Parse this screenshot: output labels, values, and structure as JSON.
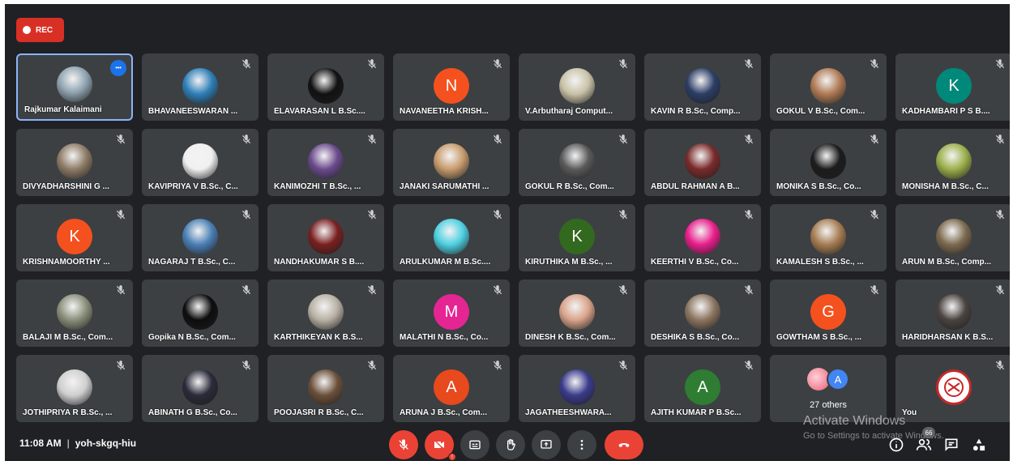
{
  "meeting": {
    "rec_label": "REC",
    "time": "11:08 AM",
    "separator": "|",
    "code": "yoh-skgq-hiu",
    "people_badge": "66",
    "watermark_title": "Activate Windows",
    "watermark_sub": "Go to Settings to activate Windows."
  },
  "colors": {
    "background": "#202124",
    "tile": "#3c4043",
    "rec": "#d93025",
    "end_call": "#ea4335",
    "self_border": "#8ab4f8"
  },
  "rows": [
    [
      {
        "name": "Rajkumar Kalaimani",
        "kind": "photo",
        "color": "#8fa3b0",
        "self": true
      },
      {
        "name": "BHAVANEESWARAN ...",
        "kind": "photo",
        "color": "#2f7fb8"
      },
      {
        "name": "ELAVARASAN L B.Sc....",
        "kind": "photo",
        "color": "#111111"
      },
      {
        "name": "NAVANEETHA KRISH...",
        "kind": "letter",
        "letter": "N",
        "color": "#f4511e"
      },
      {
        "name": "V.Arbutharaj Comput...",
        "kind": "photo",
        "color": "#c9c2a8"
      },
      {
        "name": "KAVIN R B.Sc., Comp...",
        "kind": "photo",
        "color": "#2c3e66"
      },
      {
        "name": "GOKUL V B.Sc., Com...",
        "kind": "photo",
        "color": "#b07a55"
      },
      {
        "name": "KADHAMBARI P S B....",
        "kind": "letter",
        "letter": "K",
        "color": "#00897b"
      }
    ],
    [
      {
        "name": "DIVYADHARSHINI G ...",
        "kind": "photo",
        "color": "#8d7b66"
      },
      {
        "name": "KAVIPRIYA V B.Sc., C...",
        "kind": "photo",
        "color": "#f0f0f0"
      },
      {
        "name": "KANIMOZHI T B.Sc., ...",
        "kind": "photo",
        "color": "#6a4a8c"
      },
      {
        "name": "JANAKI SARUMATHI ...",
        "kind": "photo",
        "color": "#c89b6d"
      },
      {
        "name": "GOKUL R B.Sc., Com...",
        "kind": "photo",
        "color": "#5a5a5a"
      },
      {
        "name": "ABDUL RAHMAN A B...",
        "kind": "photo",
        "color": "#7a2a2a"
      },
      {
        "name": "MONIKA S B.Sc., Co...",
        "kind": "photo",
        "color": "#1c1c1c"
      },
      {
        "name": "MONISHA M B.Sc., C...",
        "kind": "photo",
        "color": "#9bb04a"
      }
    ],
    [
      {
        "name": "KRISHNAMOORTHY ...",
        "kind": "letter",
        "letter": "K",
        "color": "#f4511e"
      },
      {
        "name": "NAGARAJ T B.Sc., C...",
        "kind": "photo",
        "color": "#4a7fb5"
      },
      {
        "name": "NANDHAKUMAR S B....",
        "kind": "photo",
        "color": "#7a1f1f"
      },
      {
        "name": "ARULKUMAR M B.Sc....",
        "kind": "photo",
        "color": "#4dd0e1"
      },
      {
        "name": "KIRUTHIKA M B.Sc., ...",
        "kind": "letter",
        "letter": "K",
        "color": "#33691e"
      },
      {
        "name": "KEERTHI V B.Sc., Co...",
        "kind": "photo",
        "color": "#e91e8c"
      },
      {
        "name": "KAMALESH S B.Sc., ...",
        "kind": "photo",
        "color": "#a67c52"
      },
      {
        "name": "ARUN M B.Sc., Comp...",
        "kind": "photo",
        "color": "#7d6a4f"
      }
    ],
    [
      {
        "name": "BALAJI M B.Sc., Com...",
        "kind": "photo",
        "color": "#8a8f7a"
      },
      {
        "name": "Gopika N B.Sc., Com...",
        "kind": "photo",
        "color": "#0d0d0d"
      },
      {
        "name": "KARTHIKEYAN K B.S...",
        "kind": "photo",
        "color": "#b8b0a4"
      },
      {
        "name": "MALATHI N B.Sc., Co...",
        "kind": "letter",
        "letter": "M",
        "color": "#e52592"
      },
      {
        "name": "DINESH K B.Sc., Com...",
        "kind": "photo",
        "color": "#d9a38a"
      },
      {
        "name": "DESHIKA S B.Sc., Co...",
        "kind": "photo",
        "color": "#8c7560"
      },
      {
        "name": "GOWTHAM S B.Sc., ...",
        "kind": "letter",
        "letter": "G",
        "color": "#f4511e"
      },
      {
        "name": "HARIDHARSAN K B.S...",
        "kind": "photo",
        "color": "#4a4340"
      }
    ],
    [
      {
        "name": "JOTHIPRIYA R B.Sc., ...",
        "kind": "photo",
        "color": "#cfcfcf"
      },
      {
        "name": "ABINATH G B.Sc., Co...",
        "kind": "photo",
        "color": "#2a2a3a"
      },
      {
        "name": "POOJASRI R B.Sc., C...",
        "kind": "photo",
        "color": "#6b4f3a"
      },
      {
        "name": "ARUNA J B.Sc., Com...",
        "kind": "letter",
        "letter": "A",
        "color": "#e8491d"
      },
      {
        "name": "JAGATHEESHWARA...",
        "kind": "photo",
        "color": "#3a3a8c"
      },
      {
        "name": "AJITH KUMAR P B.Sc...",
        "kind": "letter",
        "letter": "A",
        "color": "#2e7d32"
      },
      {
        "name": "27 others",
        "kind": "others",
        "letter": "A",
        "color": "#e85d75"
      },
      {
        "name": "You",
        "kind": "photo",
        "color": "#ffffff",
        "you": true
      }
    ]
  ],
  "controls": [
    {
      "id": "mic",
      "icon": "mic-off-icon",
      "red": true
    },
    {
      "id": "cam",
      "icon": "camera-off-icon",
      "red": true
    },
    {
      "id": "captions",
      "icon": "captions-icon"
    },
    {
      "id": "hand",
      "icon": "raise-hand-icon"
    },
    {
      "id": "present",
      "icon": "present-screen-icon"
    },
    {
      "id": "more",
      "icon": "more-options-icon"
    },
    {
      "id": "end",
      "icon": "end-call-icon"
    }
  ]
}
